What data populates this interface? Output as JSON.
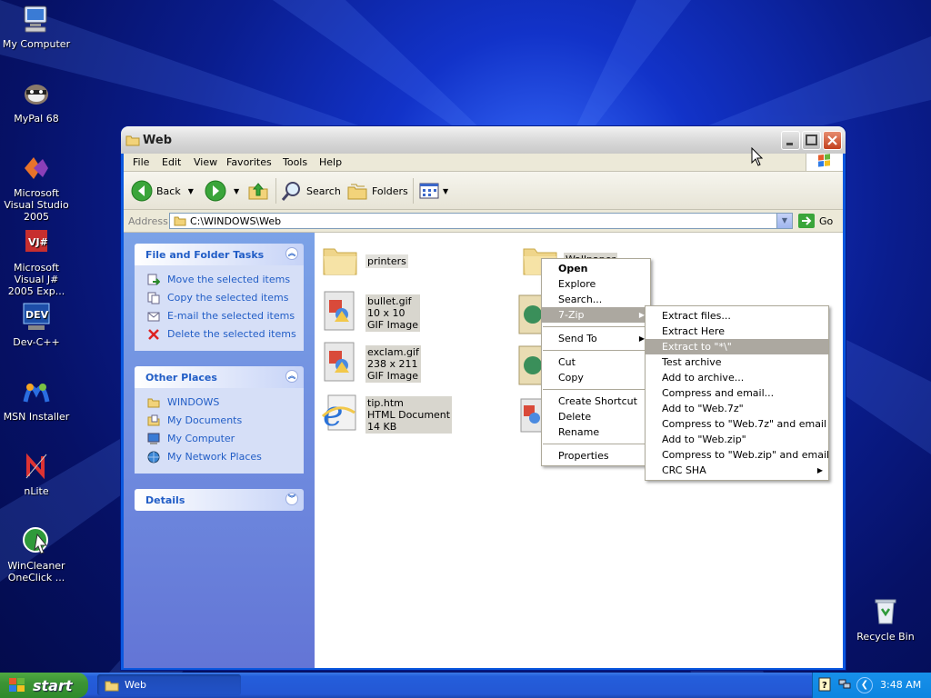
{
  "desktop": {
    "icons": [
      {
        "label": "My Computer",
        "icon": "my-computer-icon"
      },
      {
        "label": "MyPal 68",
        "icon": "mypal-icon"
      },
      {
        "label": "Microsoft Visual Studio 2005",
        "icon": "visual-studio-icon"
      },
      {
        "label": "Microsoft Visual J# 2005 Exp...",
        "icon": "visual-jsharp-icon"
      },
      {
        "label": "Dev-C++",
        "icon": "dev-cpp-icon"
      },
      {
        "label": "MSN Installer",
        "icon": "msn-icon"
      },
      {
        "label": "nLite",
        "icon": "nlite-icon"
      },
      {
        "label": "WinCleaner OneClick ...",
        "icon": "wincleaner-icon"
      },
      {
        "label": "Recycle Bin",
        "icon": "recycle-bin-icon"
      }
    ]
  },
  "window": {
    "title": "Web",
    "menu": [
      "File",
      "Edit",
      "View",
      "Favorites",
      "Tools",
      "Help"
    ],
    "toolbar": {
      "back": "Back",
      "search": "Search",
      "folders": "Folders"
    },
    "address": {
      "label": "Address",
      "value": "C:\\WINDOWS\\Web",
      "go": "Go"
    },
    "panels": {
      "file_tasks": {
        "title": "File and Folder Tasks",
        "items": [
          "Move the selected items",
          "Copy the selected items",
          "E-mail the selected items",
          "Delete the selected items"
        ]
      },
      "other_places": {
        "title": "Other Places",
        "items": [
          "WINDOWS",
          "My Documents",
          "My Computer",
          "My Network Places"
        ]
      },
      "details": {
        "title": "Details"
      }
    },
    "files": [
      {
        "name": "printers",
        "line2": "",
        "line3": ""
      },
      {
        "name": "Wallpaper",
        "line2": "",
        "line3": ""
      },
      {
        "name": "bullet.gif",
        "line2": "10 x 10",
        "line3": "GIF Image"
      },
      {
        "name": "exclam.gif",
        "line2": "238 x 211",
        "line3": "GIF Image"
      },
      {
        "name": "tip.htm",
        "line2": "HTML Document",
        "line3": "14 KB"
      }
    ]
  },
  "context_menu": {
    "items": [
      "Open",
      "Explore",
      "Search...",
      "7-Zip",
      "Send To",
      "Cut",
      "Copy",
      "Create Shortcut",
      "Delete",
      "Rename",
      "Properties"
    ]
  },
  "zip_submenu": {
    "items": [
      "Extract files...",
      "Extract Here",
      "Extract to \"*\\\"",
      "Test archive",
      "Add to archive...",
      "Compress and email...",
      "Add to \"Web.7z\"",
      "Compress to \"Web.7z\" and email",
      "Add to \"Web.zip\"",
      "Compress to \"Web.zip\" and email",
      "CRC SHA"
    ]
  },
  "taskbar": {
    "start": "start",
    "window_button": "Web",
    "clock": "3:48 AM"
  }
}
